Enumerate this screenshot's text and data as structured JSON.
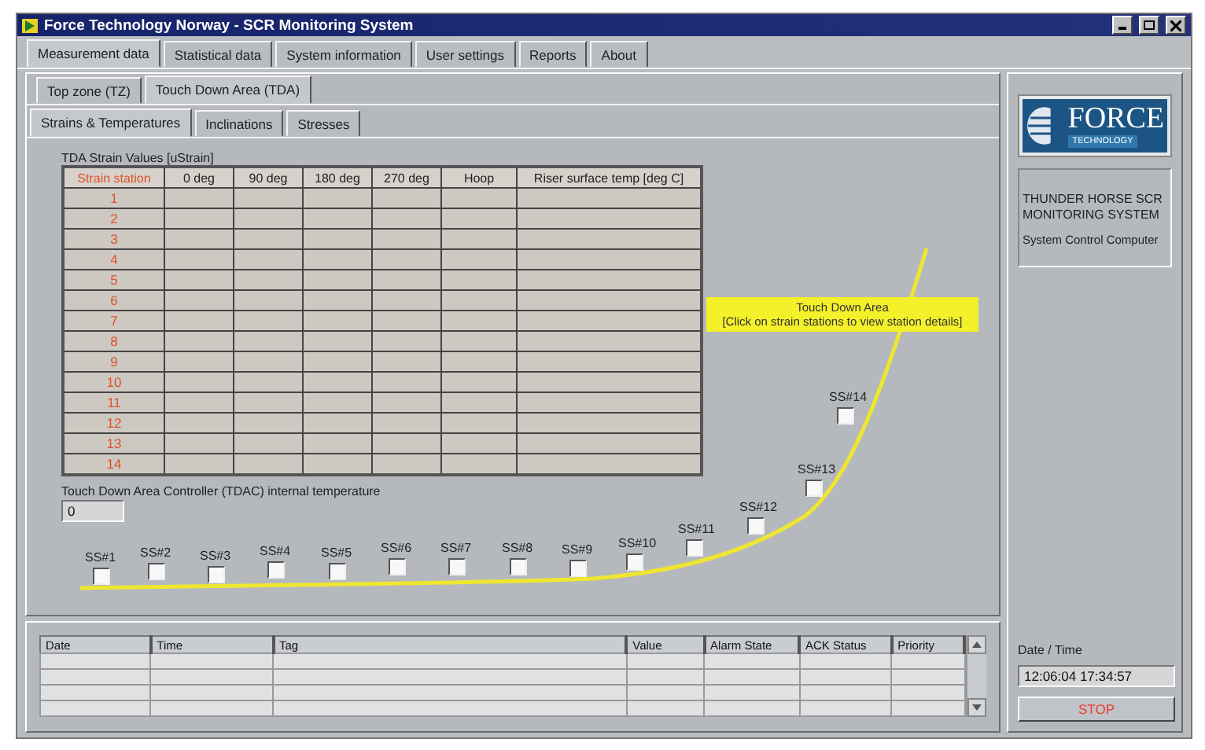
{
  "window": {
    "title": "Force Technology Norway -  SCR Monitoring System"
  },
  "main_tabs": [
    {
      "label": "Measurement data",
      "selected": true
    },
    {
      "label": "Statistical data",
      "selected": false
    },
    {
      "label": "System information",
      "selected": false
    },
    {
      "label": "User settings",
      "selected": false
    },
    {
      "label": "Reports",
      "selected": false
    },
    {
      "label": "About",
      "selected": false
    }
  ],
  "zone_tabs": [
    {
      "label": "Top zone (TZ)",
      "selected": false
    },
    {
      "label": "Touch Down Area (TDA)",
      "selected": true
    }
  ],
  "view_tabs": [
    {
      "label": "Strains & Temperatures",
      "selected": true
    },
    {
      "label": "Inclinations",
      "selected": false
    },
    {
      "label": "Stresses",
      "selected": false
    }
  ],
  "strain_table": {
    "title": "TDA Strain Values [uStrain]",
    "columns": [
      "Strain station",
      "0 deg",
      "90 deg",
      "180 deg",
      "270 deg",
      "Hoop",
      "Riser surface temp [deg C]"
    ],
    "rows": [
      "1",
      "2",
      "3",
      "4",
      "5",
      "6",
      "7",
      "8",
      "9",
      "10",
      "11",
      "12",
      "13",
      "14"
    ]
  },
  "tdac": {
    "label": "Touch Down Area Controller (TDAC) internal temperature",
    "value": "0"
  },
  "stations": [
    {
      "label": "SS#1",
      "checked": false
    },
    {
      "label": "SS#2",
      "checked": false
    },
    {
      "label": "SS#3",
      "checked": false
    },
    {
      "label": "SS#4",
      "checked": false
    },
    {
      "label": "SS#5",
      "checked": false
    },
    {
      "label": "SS#6",
      "checked": false
    },
    {
      "label": "SS#7",
      "checked": false
    },
    {
      "label": "SS#8",
      "checked": false
    },
    {
      "label": "SS#9",
      "checked": false
    },
    {
      "label": "SS#10",
      "checked": false
    },
    {
      "label": "SS#11",
      "checked": false
    },
    {
      "label": "SS#12",
      "checked": false
    },
    {
      "label": "SS#13",
      "checked": false
    },
    {
      "label": "SS#14",
      "checked": false
    }
  ],
  "callout": {
    "title": "Touch Down Area",
    "hint": "[Click on strain stations to view station details]"
  },
  "alarm_table": {
    "columns": [
      "Date",
      "Time",
      "Tag",
      "Value",
      "Alarm State",
      "ACK Status",
      "Priority"
    ]
  },
  "logo": {
    "name": "FORCE",
    "sub": "TECHNOLOGY"
  },
  "system_box": {
    "title": "THUNDER HORSE SCR MONITORING SYSTEM",
    "subtitle": "System Control Computer"
  },
  "datetime": {
    "label": "Date / Time",
    "value": "12:06:04 17:34:57"
  },
  "stop_button": {
    "label": "STOP"
  }
}
